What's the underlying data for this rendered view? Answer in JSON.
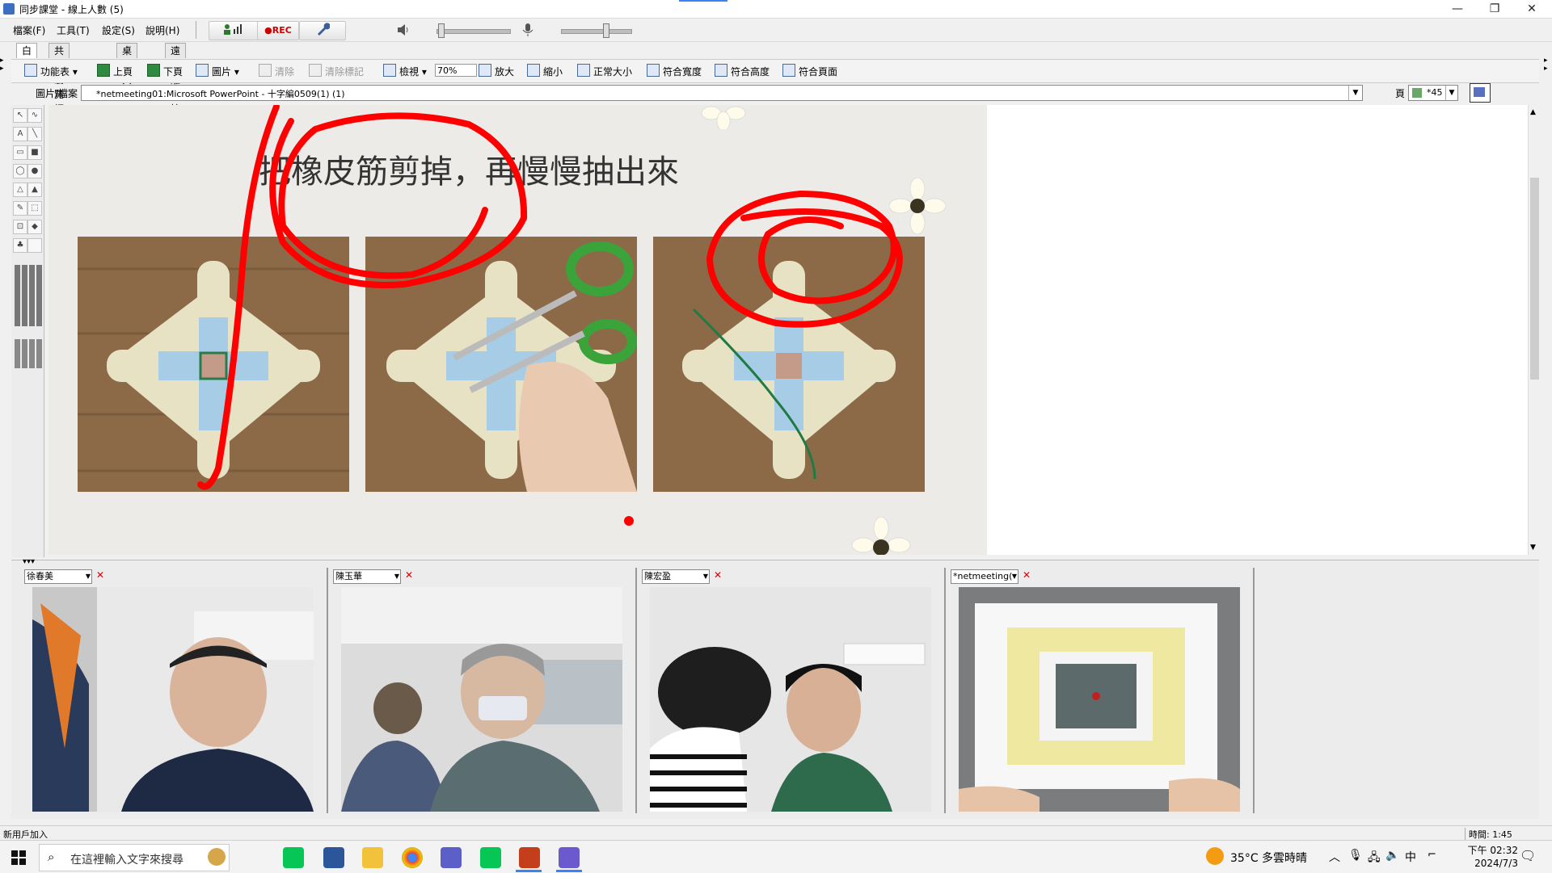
{
  "window": {
    "title": "同步課堂 - 線上人數 (5)",
    "min_glyph": "—",
    "max_glyph": "❐",
    "close_glyph": "✕"
  },
  "menu": [
    "檔案(F)",
    "工具(T)",
    "設定(S)",
    "說明(H)"
  ],
  "toolbar1": {
    "rec_label": "REC"
  },
  "tabs": [
    "白板",
    "共同瀏覽網頁",
    "桌面共享",
    "遠距離操控"
  ],
  "toolbar2": {
    "menu_label": "功能表",
    "prev_label": "上頁",
    "next_label": "下頁",
    "image_label": "圖片",
    "clear_label": "清除",
    "clear_marks_label": "清除標記",
    "view_label": "檢視",
    "zoom_value": "70%",
    "zoom_in_label": "放大",
    "zoom_out_label": "縮小",
    "normal_size_label": "正常大小",
    "fit_width_label": "符合寬度",
    "fit_height_label": "符合高度",
    "fit_page_label": "符合頁面"
  },
  "file_row": {
    "label": "圖片/檔案",
    "file_value": "*netmeeting01:Microsoft PowerPoint - 十字編0509(1) (1)",
    "page_label": "頁",
    "page_value": "*45"
  },
  "slide": {
    "text": "把橡皮筋剪掉，再慢慢抽出來"
  },
  "video_panels": [
    {
      "name": "徐春美"
    },
    {
      "name": "陳玉華"
    },
    {
      "name": "陳宏盈"
    },
    {
      "name": "*netmeeting("
    }
  ],
  "status": {
    "left": "新用戶加入",
    "right": "時間: 1:45"
  },
  "taskbar": {
    "search_placeholder": "在這裡輸入文字來搜尋",
    "weather": "35°C 多雲時晴",
    "ime": "中",
    "time": "下午 02:32",
    "date": "2024/7/3"
  },
  "colors": {
    "accent": "#3b82f6",
    "annotation_red": "#ff0000"
  }
}
